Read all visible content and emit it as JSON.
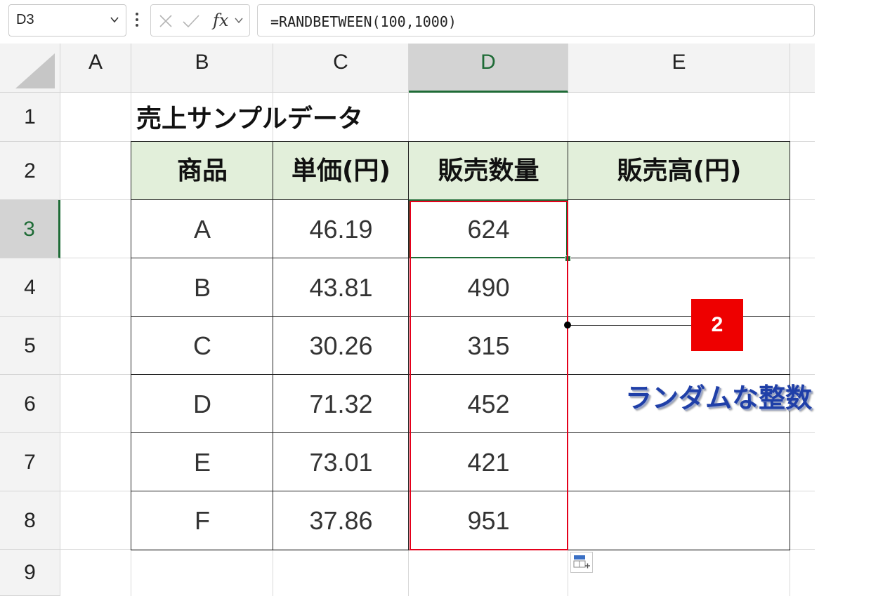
{
  "formula_bar": {
    "name_box": "D3",
    "formula": "=RANDBETWEEN(100,1000)",
    "fx_label": "fx"
  },
  "columns": [
    "A",
    "B",
    "C",
    "D",
    "E"
  ],
  "rows": [
    "1",
    "2",
    "3",
    "4",
    "5",
    "6",
    "7",
    "8",
    "9"
  ],
  "sheet": {
    "title": "売上サンプルデータ",
    "headers": [
      "商品",
      "単価(円)",
      "販売数量",
      "販売高(円)"
    ],
    "data_rows": [
      {
        "product": "A",
        "price": "46.19",
        "qty": "624",
        "sales": ""
      },
      {
        "product": "B",
        "price": "43.81",
        "qty": "490",
        "sales": ""
      },
      {
        "product": "C",
        "price": "30.26",
        "qty": "315",
        "sales": ""
      },
      {
        "product": "D",
        "price": "71.32",
        "qty": "452",
        "sales": ""
      },
      {
        "product": "E",
        "price": "73.01",
        "qty": "421",
        "sales": ""
      },
      {
        "product": "F",
        "price": "37.86",
        "qty": "951",
        "sales": ""
      }
    ]
  },
  "annotation": {
    "badge": "2",
    "note": "ランダムな整数",
    "badge_color": "#ee0000",
    "note_color": "#1f3fa8",
    "highlight_color": "#e4001b"
  },
  "selection": {
    "column": "D",
    "row": "3",
    "accent": "#1e6b36"
  }
}
